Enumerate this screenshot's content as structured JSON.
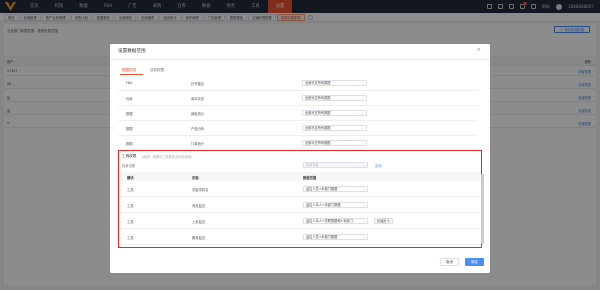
{
  "nav": {
    "items": [
      "首页",
      "利润",
      "数据",
      "FBA",
      "广告",
      "采购",
      "仓库",
      "数据",
      "财务",
      "工具",
      "设置"
    ],
    "active_index": 10,
    "right": {
      "help": "帮助",
      "account": "1888888807",
      "notice_count": "4"
    }
  },
  "tabs": {
    "items": [
      "首页",
      "利润报表",
      "账户业务管理",
      "采购计划",
      "数据报告",
      "店铺授权",
      "利润报表",
      "选品统计",
      "操作管理",
      "广告管理",
      "数据看板",
      "店铺权限配置",
      "数据权限配置"
    ],
    "active_index": 12
  },
  "page": {
    "description": "业务部门数据范围：数据来源范围",
    "add_button": "+ 添加权限配置",
    "header": "用户",
    "header_op": "操作",
    "rows": [
      {
        "name": "17357",
        "op": "设置数据"
      },
      {
        "name": "88",
        "op": "设置数据"
      },
      {
        "name": "加",
        "op": "设置数据"
      },
      {
        "name": "运",
        "op": "设置数据"
      },
      {
        "name": "0",
        "op": "设置数据"
      }
    ]
  },
  "dialog": {
    "title": "设置数据范围",
    "close": "×",
    "tabs": [
      "数据权限",
      "业务权限"
    ],
    "active_tab": 0,
    "rows": [
      {
        "group": "FBA",
        "name": "补货建议",
        "scope": "全部可见所有数据"
      },
      {
        "group": "仓库",
        "name": "库存状态",
        "scope": "全部可见所有数据"
      },
      {
        "group": "数据",
        "name": "销量统计",
        "scope": "全部可见所有数据"
      },
      {
        "group": "数据",
        "name": "产品分析",
        "scope": "全部可见所有数据"
      },
      {
        "group": "数据",
        "name": "订单统计",
        "scope": "全部可见所有数据"
      }
    ],
    "section": {
      "title": "工具权限",
      "hint": "（说明：新模块工具需在此页面添加）",
      "bulk_label": "批量设置",
      "bulk_placeholder": "批量设置",
      "apply": "应用",
      "columns": [
        "模块",
        "页面",
        "数据范围"
      ],
      "rows": [
        {
          "group": "工具",
          "name": "关键词排名",
          "scope": "监控人员+本部门数据"
        },
        {
          "group": "工具",
          "name": "商品监控",
          "scope": "监控人本人+本部门数据"
        },
        {
          "group": "工具",
          "name": "上架监控",
          "scope": "监控人本人+关联数据和+本部门",
          "chip": "管理员",
          "chip_close": "×"
        },
        {
          "group": "工具",
          "name": "跟卖监控",
          "scope": "监控人员+本部门数据"
        }
      ]
    },
    "buttons": {
      "cancel": "取消",
      "ok": "确定"
    }
  },
  "colors": {
    "accent": "#e9552f",
    "primary": "#4a8ef7",
    "highlight": "#e02b2b",
    "nav_bg": "#242a3a"
  }
}
